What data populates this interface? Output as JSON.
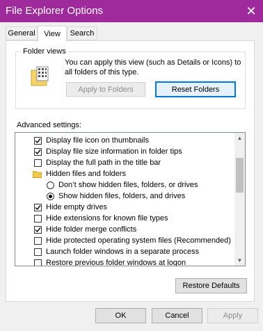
{
  "window": {
    "title": "File Explorer Options",
    "close_symbol": "✕"
  },
  "tabs": [
    {
      "label": "General",
      "active": false
    },
    {
      "label": "View",
      "active": true
    },
    {
      "label": "Search",
      "active": false
    }
  ],
  "folder_views": {
    "label": "Folder views",
    "description": "You can apply this view (such as Details or Icons) to all folders of this type.",
    "apply_button": "Apply to Folders",
    "reset_button": "Reset Folders"
  },
  "advanced": {
    "label": "Advanced settings:",
    "items": [
      {
        "kind": "checkbox",
        "checked": true,
        "label": "Display file icon on thumbnails"
      },
      {
        "kind": "checkbox",
        "checked": true,
        "label": "Display file size information in folder tips"
      },
      {
        "kind": "checkbox",
        "checked": false,
        "label": "Display the full path in the title bar"
      },
      {
        "kind": "folder",
        "label": "Hidden files and folders"
      },
      {
        "kind": "radio",
        "selected": false,
        "label": "Don’t show hidden files, folders, or drives"
      },
      {
        "kind": "radio",
        "selected": true,
        "label": "Show hidden files, folders, and drives"
      },
      {
        "kind": "checkbox",
        "checked": true,
        "label": "Hide empty drives"
      },
      {
        "kind": "checkbox",
        "checked": false,
        "label": "Hide extensions for known file types"
      },
      {
        "kind": "checkbox",
        "checked": true,
        "label": "Hide folder merge conflicts"
      },
      {
        "kind": "checkbox",
        "checked": false,
        "label": "Hide protected operating system files (Recommended)"
      },
      {
        "kind": "checkbox",
        "checked": false,
        "label": "Launch folder windows in a separate process"
      },
      {
        "kind": "checkbox",
        "checked": false,
        "label": "Restore previous folder windows at logon"
      }
    ],
    "scroll_up": "▲",
    "scroll_down": "▼"
  },
  "restore_defaults": "Restore Defaults",
  "footer": {
    "ok": "OK",
    "cancel": "Cancel",
    "apply": "Apply"
  }
}
